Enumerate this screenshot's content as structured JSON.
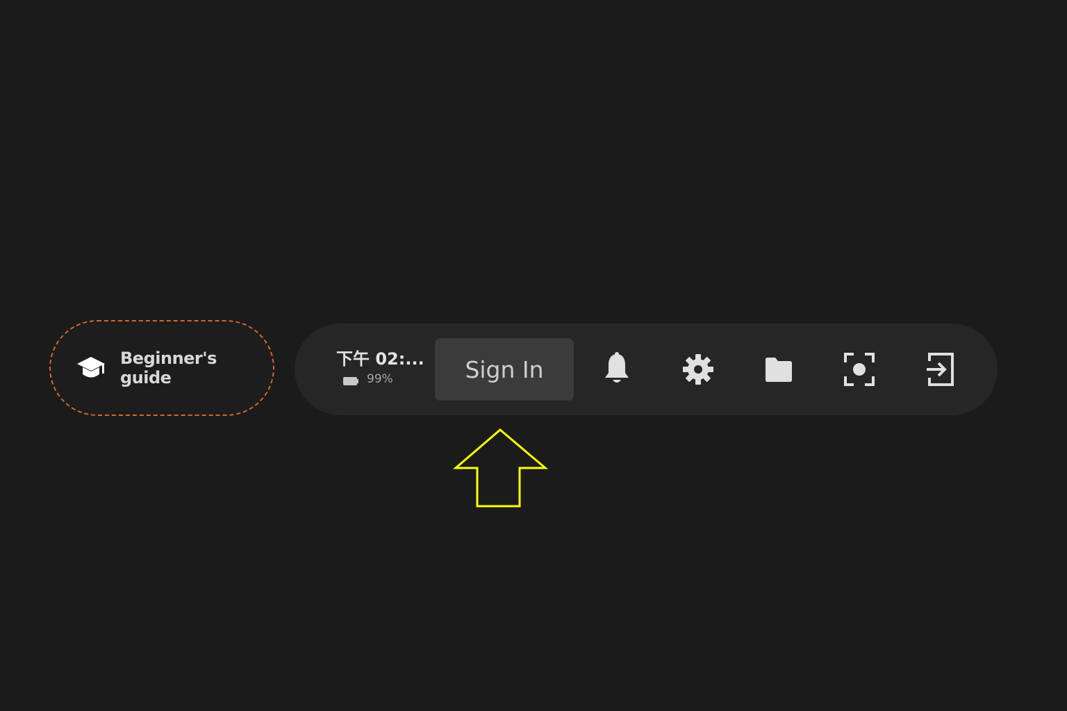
{
  "guide": {
    "label": "Beginner's guide",
    "icon": "graduation-cap-icon",
    "border_color": "#d2692a"
  },
  "status": {
    "time": "下午 02:...",
    "battery": "99%",
    "battery_icon": "battery-icon"
  },
  "toolbar": {
    "sign_in_label": "Sign In",
    "icons": [
      "bell-icon",
      "gear-icon",
      "folder-icon",
      "screenshot-icon",
      "sign-out-icon"
    ]
  },
  "annotation": {
    "arrow_icon": "up-arrow-icon",
    "arrow_color": "#ffff00"
  },
  "colors": {
    "background": "#1b1b1b",
    "toolbar": "#262626",
    "button": "#3b3b3b",
    "icon": "#e0e0e0"
  }
}
